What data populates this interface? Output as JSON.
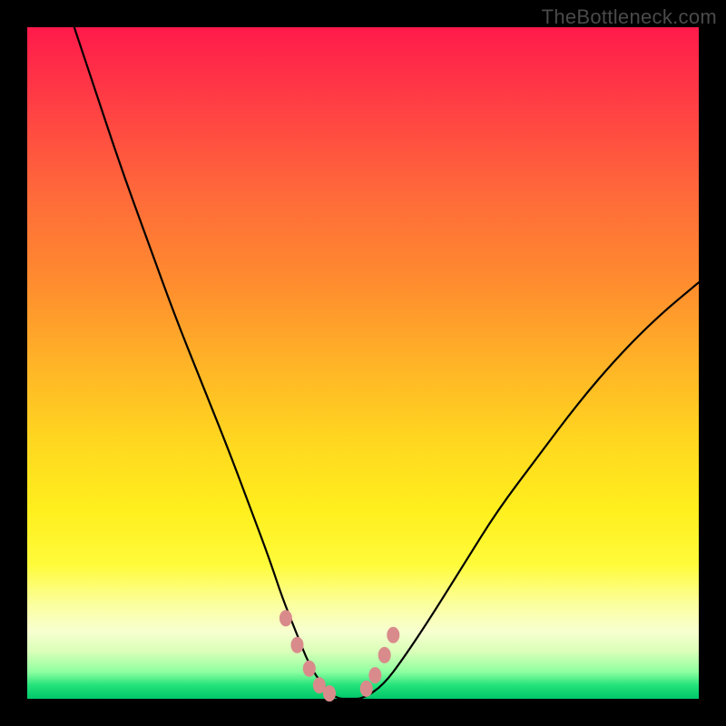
{
  "watermark": "TheBottleneck.com",
  "chart_data": {
    "type": "line",
    "title": "",
    "xlabel": "",
    "ylabel": "",
    "xlim": [
      0,
      100
    ],
    "ylim": [
      0,
      100
    ],
    "series": [
      {
        "name": "curve",
        "x": [
          7,
          10,
          14,
          18,
          22,
          26,
          30,
          33,
          36,
          38,
          40,
          42,
          44,
          46,
          48,
          50,
          53,
          56,
          60,
          65,
          70,
          76,
          82,
          88,
          94,
          100
        ],
        "y": [
          100,
          91,
          79,
          68,
          57,
          47,
          37,
          29,
          21,
          15,
          10,
          5,
          2,
          0,
          0,
          0,
          2,
          6,
          12,
          20,
          28,
          36,
          44,
          51,
          57,
          62
        ]
      }
    ],
    "markers": {
      "name": "highlight-dots",
      "color": "#d98b8b",
      "points_x": [
        38.5,
        40.2,
        42.0,
        43.5,
        45.0,
        50.5,
        51.8,
        53.2,
        54.5
      ],
      "points_y": [
        12.0,
        8.0,
        4.5,
        2.0,
        0.8,
        1.5,
        3.5,
        6.5,
        9.5
      ]
    }
  }
}
